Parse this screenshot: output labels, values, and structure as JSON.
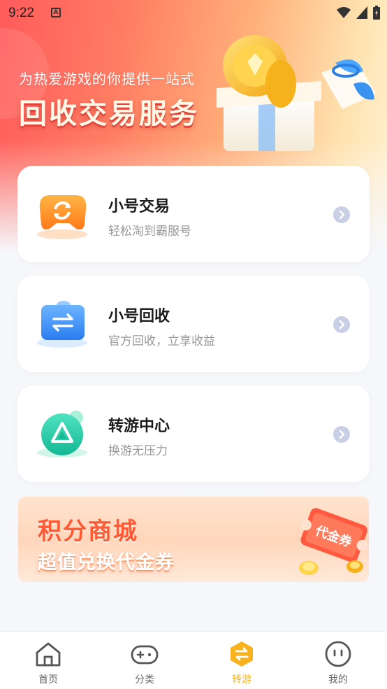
{
  "status_bar": {
    "time": "9:22",
    "app_badge": "A"
  },
  "hero": {
    "subtitle": "为热爱游戏的你提供一站式",
    "title": "回收交易服务"
  },
  "cards": [
    {
      "title": "小号交易",
      "desc": "轻松淘到霸服号",
      "icon": "game-controller-swap-icon"
    },
    {
      "title": "小号回收",
      "desc": "官方回收，立享收益",
      "icon": "recycle-folder-icon"
    },
    {
      "title": "转游中心",
      "desc": "换游无压力",
      "icon": "triangle-coin-icon"
    }
  ],
  "banner": {
    "title": "积分商城",
    "subtitle": "超值兑换代金券",
    "ticket_label": "代金券"
  },
  "tabs": [
    {
      "label": "首页",
      "icon": "home-icon",
      "active": false
    },
    {
      "label": "分类",
      "icon": "gamepad-icon",
      "active": false
    },
    {
      "label": "转游",
      "icon": "transfer-hexagon-icon",
      "active": true
    },
    {
      "label": "我的",
      "icon": "face-icon",
      "active": false
    }
  ],
  "colors": {
    "hero_start": "#ff5b5b",
    "hero_end": "#fff3d6",
    "active_tab": "#f7b21d",
    "card_title": "#1c1c1c",
    "card_desc": "#999999",
    "banner_title": "#ff5a33"
  }
}
